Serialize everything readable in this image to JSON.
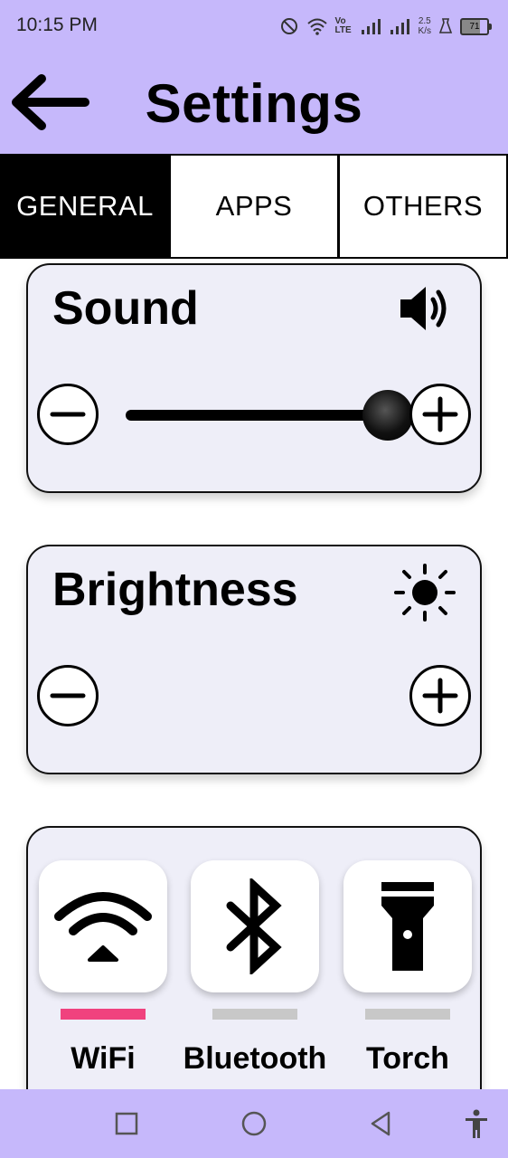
{
  "status_bar": {
    "time": "10:15 PM",
    "network": "Vo LTE",
    "speed_value": "2.5",
    "speed_unit": "K/s",
    "battery": "71",
    "icons": [
      "dnd-icon",
      "wifi-icon",
      "signal-icon",
      "signal-icon",
      "alarm-icon",
      "battery-icon"
    ]
  },
  "header": {
    "title": "Settings",
    "back_icon": "arrow-left-icon"
  },
  "tabs": [
    {
      "label": "GENERAL",
      "active": true
    },
    {
      "label": "APPS",
      "active": false
    },
    {
      "label": "OTHERS",
      "active": false
    }
  ],
  "sound": {
    "title": "Sound",
    "icon": "speaker-icon",
    "level": 1.0,
    "decrease_icon": "minus-icon",
    "increase_icon": "plus-icon"
  },
  "brightness": {
    "title": "Brightness",
    "icon": "sun-icon",
    "decrease_icon": "minus-icon",
    "increase_icon": "plus-icon"
  },
  "quick_toggles": [
    {
      "label": "WiFi",
      "icon": "wifi-icon",
      "enabled": true,
      "indicator_color": "#f0427e"
    },
    {
      "label": "Bluetooth",
      "icon": "bluetooth-icon",
      "enabled": false,
      "indicator_color": "#c8c8c8"
    },
    {
      "label": "Torch",
      "icon": "flashlight-icon",
      "enabled": false,
      "indicator_color": "#c8c8c8"
    }
  ],
  "colors": {
    "accent": "#c6b8fb",
    "card_background": "#eeeef8",
    "active_tab": "#000000"
  },
  "nav_bar": {
    "icons": [
      "square-icon",
      "circle-icon",
      "triangle-back-icon",
      "accessibility-icon"
    ]
  }
}
